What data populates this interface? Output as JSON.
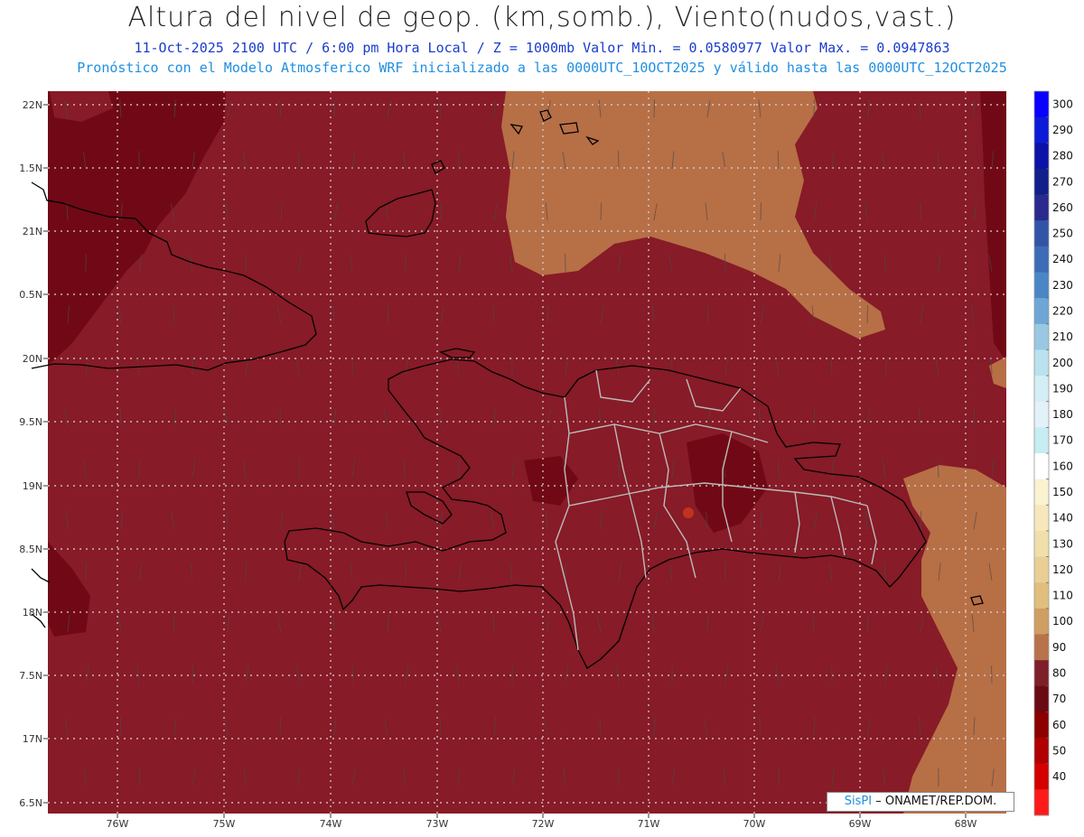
{
  "header": {
    "title": "Altura del nivel de geop. (km,somb.), Viento(nudos,vast.)",
    "line1": "11-Oct-2025  2100 UTC / 6:00 pm Hora Local / Z = 1000mb Valor Min. = 0.0580977  Valor Max. = 0.0947863",
    "line2": "Pronóstico con el Modelo Atmosferico WRF inicializado a las 0000UTC_10OCT2025 y válido hasta las  0000UTC_12OCT2025"
  },
  "axes": {
    "lat_labels": [
      "22N",
      "1.5N",
      "21N",
      "0.5N",
      "20N",
      "9.5N",
      "19N",
      "8.5N",
      "18N",
      "7.5N",
      "17N",
      "6.5N"
    ],
    "lon_labels": [
      "76W",
      "75W",
      "74W",
      "73W",
      "72W",
      "71W",
      "70W",
      "69W",
      "68W"
    ]
  },
  "colorbar": {
    "labels": [
      "300",
      "290",
      "280",
      "270",
      "260",
      "250",
      "240",
      "230",
      "220",
      "210",
      "200",
      "190",
      "180",
      "170",
      "160",
      "150",
      "140",
      "130",
      "120",
      "110",
      "100",
      "90",
      "80",
      "70",
      "60",
      "50",
      "40"
    ],
    "colors": [
      "#0a00ff",
      "#0c1bd6",
      "#0c12a8",
      "#121f8a",
      "#2a2a8e",
      "#3254a8",
      "#3c6cb8",
      "#4a86c6",
      "#6ea6d6",
      "#98c8e2",
      "#b9e2ee",
      "#d4eef6",
      "#e2f2f8",
      "#c6ecf4",
      "#ffffff",
      "#fbf2cf",
      "#f6e8bc",
      "#f1dfab",
      "#eacf94",
      "#e0bf7e",
      "#cf9e62",
      "#b8734a",
      "#7e1f2a",
      "#6a0a14",
      "#8c0000",
      "#b00000",
      "#d40000",
      "#ff1a1a"
    ]
  },
  "map": {
    "colors": {
      "base": "#871b27",
      "dark": "#700915",
      "tan": "#b76f46",
      "light": "#c0341f",
      "grid": "#d8d8d8",
      "coast": "#000000",
      "province": "#bbbbbb"
    }
  },
  "credit": {
    "brand": "SisPI",
    "text": "– ONAMET/REP.DOM."
  }
}
